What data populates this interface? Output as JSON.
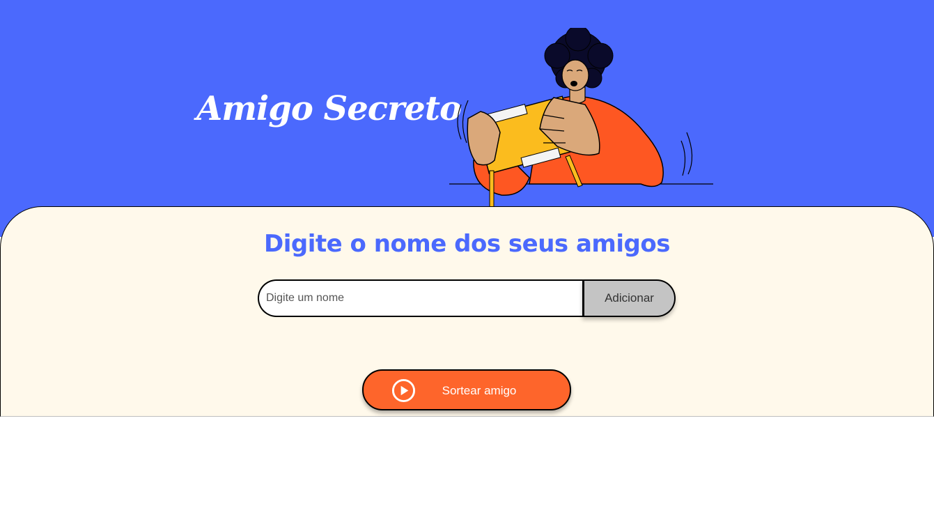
{
  "header": {
    "title": "Amigo Secreto",
    "illustration_icon": "person-with-gift-illustration",
    "background_color": "#4B69FD"
  },
  "main": {
    "heading": "Digite o nome dos seus amigos",
    "name_input": {
      "value": "",
      "placeholder": "Digite um nome"
    },
    "add_button_label": "Adicionar",
    "draw_button_label": "Sortear amigo",
    "draw_button_icon": "play-icon",
    "background_color": "#FFF9EB",
    "accent_color": "#FE652B"
  }
}
